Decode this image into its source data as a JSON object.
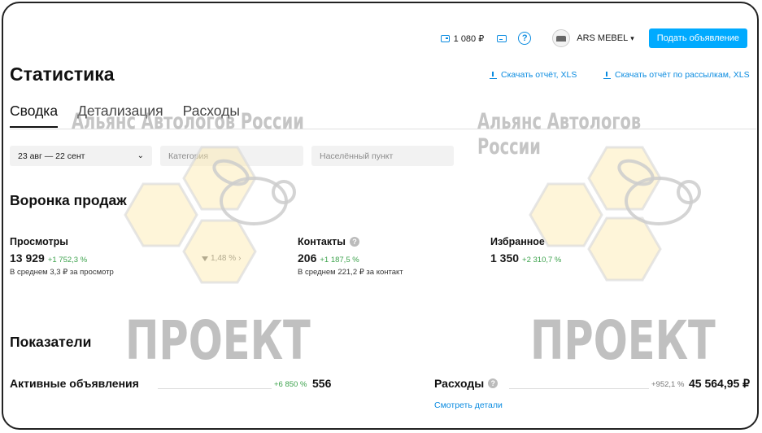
{
  "header": {
    "balance": "1 080 ₽",
    "user_name": "ARS MEBEL",
    "post_button": "Подать объявление",
    "help_glyph": "?"
  },
  "page": {
    "title": "Статистика",
    "download_report": "Скачать отчёт, XLS",
    "download_mailing": "Скачать отчёт по рассылкам, XLS"
  },
  "tabs": [
    {
      "label": "Сводка",
      "active": true
    },
    {
      "label": "Детализация",
      "active": false
    },
    {
      "label": "Расходы",
      "active": false
    }
  ],
  "filters": {
    "date_range": "23 авг — 22 сент",
    "category_placeholder": "Категория",
    "locality_placeholder": "Населённый пункт"
  },
  "funnel": {
    "title": "Воронка продаж",
    "views": {
      "label": "Просмотры",
      "value": "13 929",
      "delta": "+1 752,3 %",
      "sub": "В среднем 3,3 ₽ за просмотр"
    },
    "conversion": "1,48 %",
    "contacts": {
      "label": "Контакты",
      "value": "206",
      "delta": "+1 187,5 %",
      "sub": "В среднем 221,2 ₽ за контакт"
    },
    "favorites": {
      "label": "Избранное",
      "value": "1 350",
      "delta": "+2 310,7 %"
    }
  },
  "indicators": {
    "title": "Показатели",
    "active_ads": {
      "label": "Активные объявления",
      "delta": "+6 850 %",
      "value": "556"
    },
    "expenses": {
      "label": "Расходы",
      "delta": "+952,1 %",
      "value": "45 564,95 ₽",
      "link": "Смотреть детали"
    }
  },
  "watermarks": {
    "org_name": "Альянс Автологов России",
    "project": "ПРОЕКТ"
  },
  "colors": {
    "accent": "#00aaff",
    "link": "#0a8be0",
    "positive": "#3ca24c",
    "gray_delta": "#777777"
  }
}
